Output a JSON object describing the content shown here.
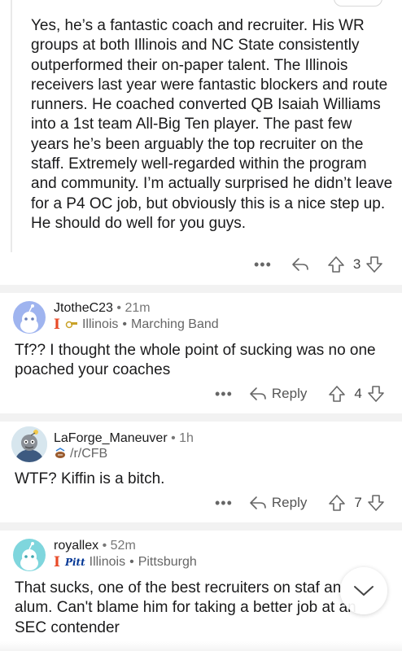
{
  "first_comment": {
    "body": "Yes, he’s a fantastic coach and recruiter. His WR groups at both Illinois and NC State consistently outperformed their on-paper talent. The Illinois receivers last year were fantastic blockers and route runners. He coached converted QB Isaiah Williams into a 1st team All-Big Ten player. The past few years he’s been arguably the top recruiter on the staff. Extremely well-regarded within the program and community. I’m actually surprised he didn’t leave for a P4 OC job, but obviously this is a nice step up. He should do well for you guys.",
    "vote_count": "3"
  },
  "comments": [
    {
      "username": "JtotheC23",
      "time": "21m",
      "flair_text": "Illinois",
      "flair_extra": "Marching Band",
      "body": "Tf?? I thought the whole point of sucking was no one poached your coaches",
      "reply_label": "Reply",
      "vote_count": "4",
      "avatar_color": "#9fb4ef"
    },
    {
      "username": "LaForge_Maneuver",
      "time": "1h",
      "flair_text": "/r/CFB",
      "body": "WTF? Kiffin is a bitch.",
      "reply_label": "Reply",
      "vote_count": "7",
      "avatar_color": "#cfe3ef"
    },
    {
      "username": "royallex",
      "time": "52m",
      "flair_text": "Illinois",
      "flair_extra": "Pittsburgh",
      "flair_badge": "Pitt",
      "body": "That sucks, one of the best recruiters on staf an alum. Can't blame him for taking a better job at an SEC contender",
      "avatar_color": "#7fd6dd"
    }
  ],
  "separator_dot": "•",
  "more_dots": "•••",
  "colors": {
    "accent_illini": "#e84a27",
    "pitt_blue": "#003594",
    "text": "#1a1a1b",
    "muted": "#777777"
  },
  "icons": {
    "reply": "reply-arrow-icon",
    "upvote": "upvote-arrow-icon",
    "downvote": "downvote-arrow-icon",
    "more": "more-dots-icon",
    "scroll": "chevron-down-icon"
  }
}
